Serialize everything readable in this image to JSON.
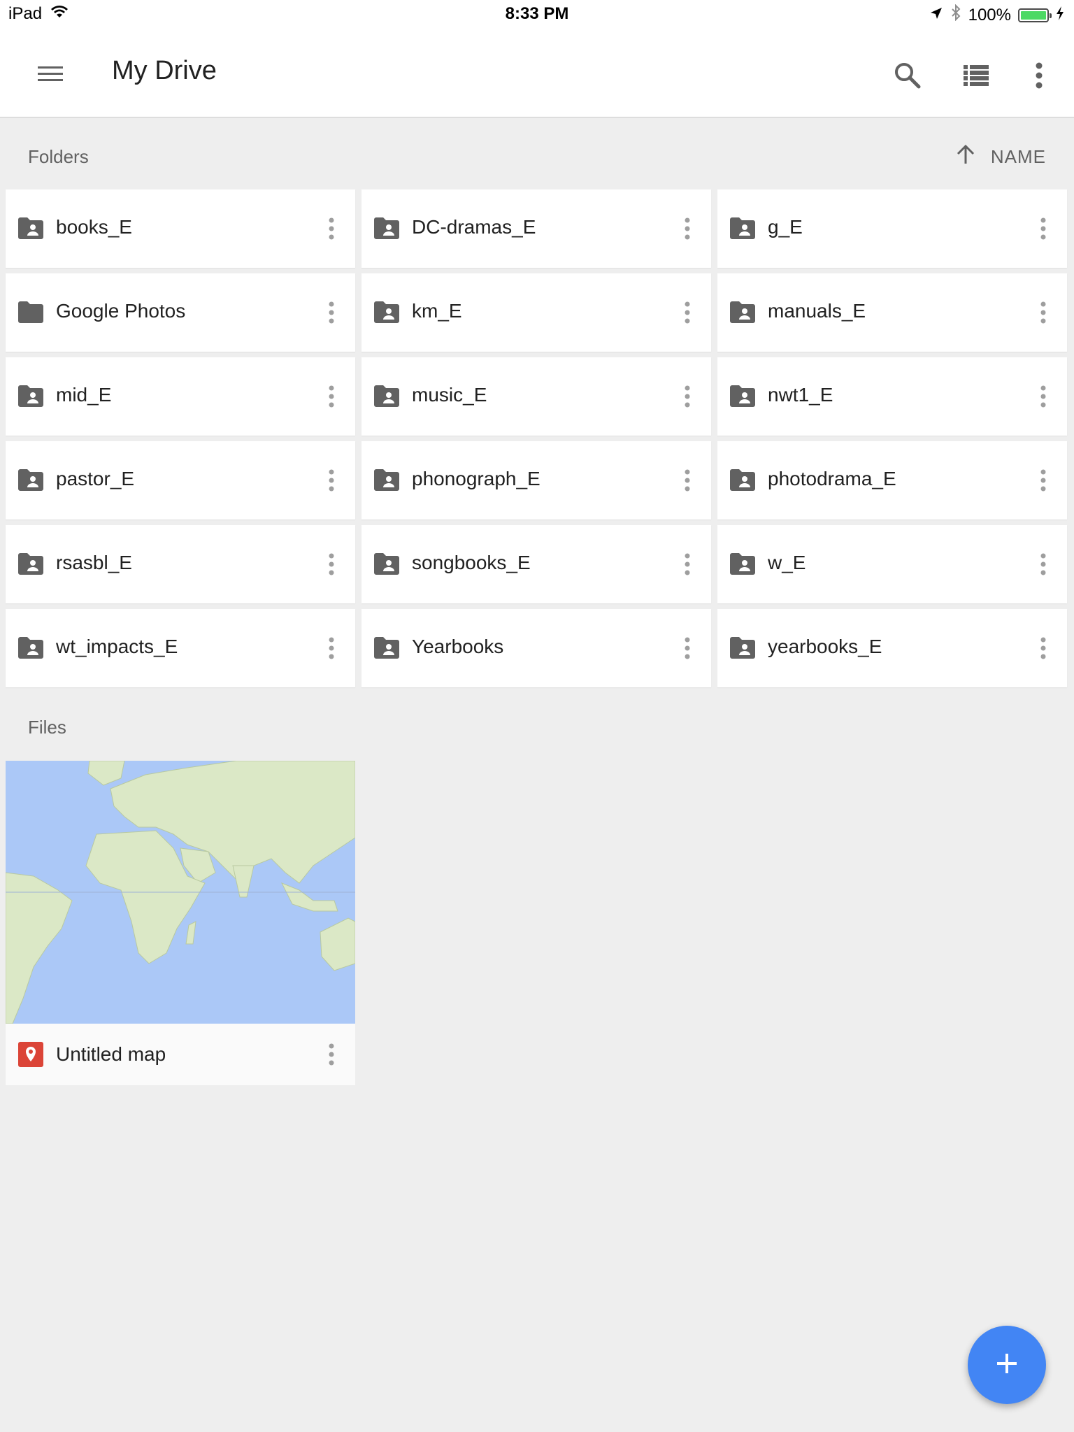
{
  "status_bar": {
    "device": "iPad",
    "time": "8:33 PM",
    "battery_percent": "100%",
    "battery_level": 1.0,
    "wifi_icon": "wifi-icon",
    "location_icon": "location-arrow-icon",
    "bluetooth_icon": "bluetooth-icon",
    "charging_icon": "charging-bolt-icon"
  },
  "app_bar": {
    "title": "My Drive",
    "menu_icon": "hamburger-menu-icon",
    "actions": [
      "search-icon",
      "list-view-icon",
      "more-vert-icon"
    ]
  },
  "folders_section": {
    "label": "Folders",
    "sort": {
      "icon": "arrow-up-icon",
      "label": "NAME"
    },
    "items": [
      {
        "name": "books_E",
        "shared": true
      },
      {
        "name": "DC-dramas_E",
        "shared": true
      },
      {
        "name": "g_E",
        "shared": true
      },
      {
        "name": "Google Photos",
        "shared": false
      },
      {
        "name": "km_E",
        "shared": true
      },
      {
        "name": "manuals_E",
        "shared": true
      },
      {
        "name": "mid_E",
        "shared": true
      },
      {
        "name": "music_E",
        "shared": true
      },
      {
        "name": "nwt1_E",
        "shared": true
      },
      {
        "name": "pastor_E",
        "shared": true
      },
      {
        "name": "phonograph_E",
        "shared": true
      },
      {
        "name": "photodrama_E",
        "shared": true
      },
      {
        "name": "rsasbl_E",
        "shared": true
      },
      {
        "name": "songbooks_E",
        "shared": true
      },
      {
        "name": "w_E",
        "shared": true
      },
      {
        "name": "wt_impacts_E",
        "shared": true
      },
      {
        "name": "Yearbooks",
        "shared": true
      },
      {
        "name": "yearbooks_E",
        "shared": true
      }
    ]
  },
  "files_section": {
    "label": "Files",
    "items": [
      {
        "name": "Untitled map",
        "icon": "map-pin-icon",
        "thumbnail": "world-map-thumbnail"
      }
    ]
  },
  "fab": {
    "icon": "plus-icon"
  },
  "colors": {
    "background": "#eeeeee",
    "card": "#ffffff",
    "folder_icon": "#616161",
    "fab": "#4285f4",
    "map_pin": "#db4437",
    "map_water": "#abc8f7",
    "map_land": "#dbe8c6"
  }
}
